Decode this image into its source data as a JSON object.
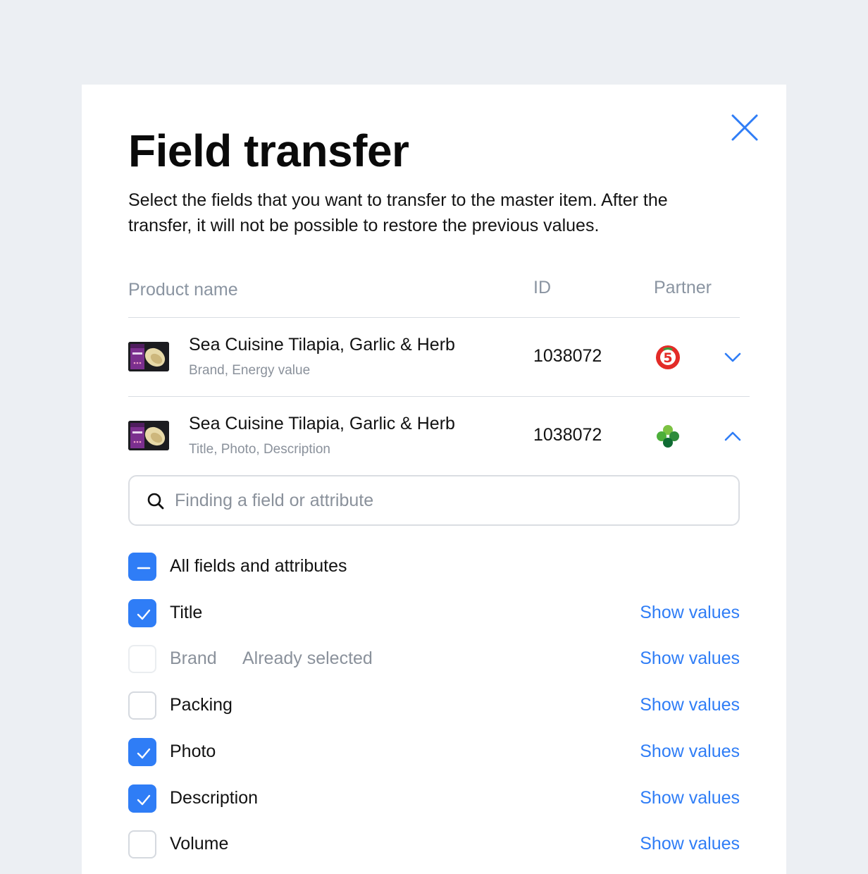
{
  "dialog": {
    "title": "Field transfer",
    "description": "Select the fields that you want to transfer to the master item. After the transfer, it will not be possible to restore the previous values.",
    "close_icon": "close-icon",
    "accent_color": "#2f7df6"
  },
  "table": {
    "headers": {
      "product_name": "Product name",
      "id": "ID",
      "partner": "Partner"
    },
    "rows": [
      {
        "name": "Sea Cuisine Tilapia, Garlic & Herb",
        "fields": "Brand, Energy value",
        "id": "1038072",
        "partner_icon": "pyaterochka-logo-icon",
        "expanded": false,
        "toggle_icon": "chevron-down-icon"
      },
      {
        "name": "Sea Cuisine Tilapia, Garlic & Herb",
        "fields": "Title, Photo, Description",
        "id": "1038072",
        "partner_icon": "perekrestok-clover-logo-icon",
        "expanded": true,
        "toggle_icon": "chevron-up-icon"
      }
    ]
  },
  "search": {
    "placeholder": "Finding a field or attribute",
    "icon": "search-icon"
  },
  "options": {
    "all": {
      "label": "All fields and attributes",
      "state": "indeterminate"
    },
    "items": [
      {
        "label": "Title",
        "checked": true,
        "action": "Show values"
      },
      {
        "label": "Brand",
        "checked": false,
        "disabled": true,
        "note": "Already selected",
        "action": "Show values"
      },
      {
        "label": "Packing",
        "checked": false,
        "action": "Show values"
      },
      {
        "label": "Photo",
        "checked": true,
        "action": "Show values"
      },
      {
        "label": "Description",
        "checked": true,
        "action": "Show values"
      },
      {
        "label": "Volume",
        "checked": false,
        "action": "Show values"
      }
    ]
  }
}
